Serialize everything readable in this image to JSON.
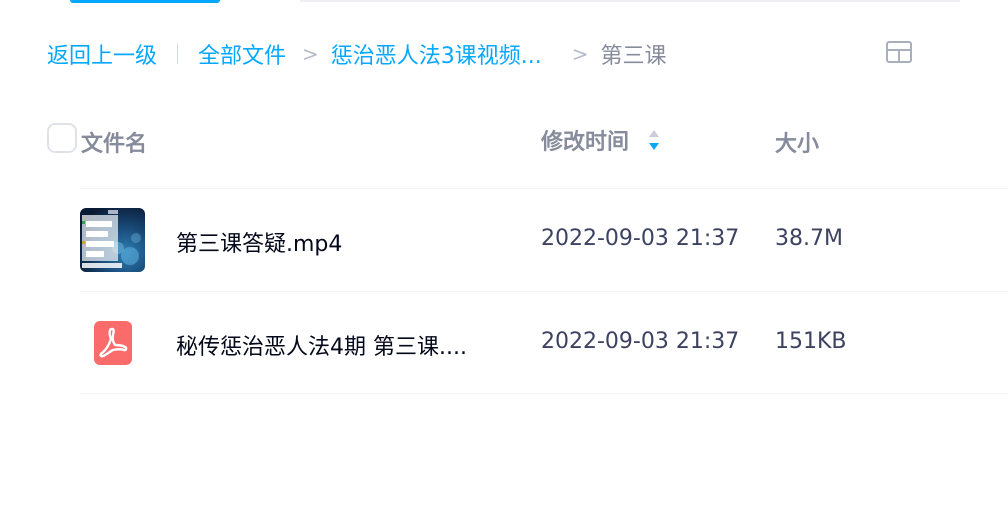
{
  "breadcrumb": {
    "back": "返回上一级",
    "root": "全部文件",
    "parent": "惩治恶人法3课视频...",
    "current": "第三课"
  },
  "header": {
    "name": "文件名",
    "modified": "修改时间",
    "size": "大小"
  },
  "files": [
    {
      "name": "第三课答疑.mp4",
      "modified": "2022-09-03 21:37",
      "size": "38.7M",
      "icon": "video-thumbnail"
    },
    {
      "name": "秘传惩治恶人法4期 第三课....",
      "modified": "2022-09-03 21:37",
      "size": "151KB",
      "icon": "pdf-icon"
    }
  ],
  "colors": {
    "accent": "#06a7ff",
    "pdf": "#fa6b6b",
    "muted": "#878c9c",
    "text": "#03081a"
  }
}
